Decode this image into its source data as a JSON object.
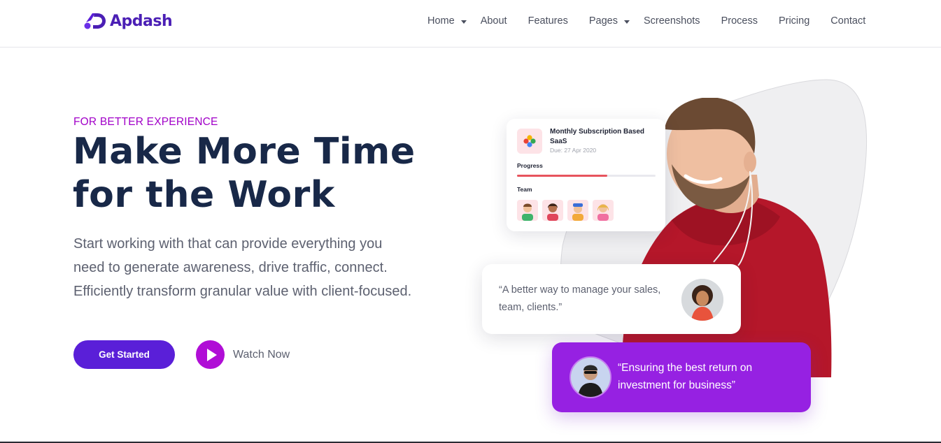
{
  "brand": {
    "name": "Apdash",
    "color": "#4b1fb5"
  },
  "nav": {
    "items": [
      {
        "label": "Home",
        "dropdown": true
      },
      {
        "label": "About",
        "dropdown": false
      },
      {
        "label": "Features",
        "dropdown": false
      },
      {
        "label": "Pages",
        "dropdown": true
      },
      {
        "label": "Screenshots",
        "dropdown": false
      },
      {
        "label": "Process",
        "dropdown": false
      },
      {
        "label": "Pricing",
        "dropdown": false
      },
      {
        "label": "Contact",
        "dropdown": false
      }
    ]
  },
  "hero": {
    "eyebrow": "FOR BETTER EXPERIENCE",
    "headline_line1": "Make More Time",
    "headline_line2": "for the Work",
    "lead": "Start working with that can provide everything you need to generate awareness, drive traffic, connect. Efficiently transform granular value with client-focused.",
    "cta_primary": "Get Started",
    "cta_secondary": "Watch Now",
    "accent_color": "#a100c8",
    "button_color": "#5a1fd8"
  },
  "subscription_card": {
    "title": "Monthly Subscription Based SaaS",
    "due": "Due: 27 Apr 2020",
    "progress_label": "Progress",
    "progress_fraction": 0.65,
    "team_label": "Team",
    "team_icons": [
      "avatar-icon",
      "avatar-icon",
      "avatar-icon",
      "avatar-icon"
    ]
  },
  "quote_cards": [
    {
      "text": "“A better way to manage your sales, team, clients.”"
    },
    {
      "text": "“Ensuring the best return on investment for business”",
      "background": "#9621e2"
    }
  ]
}
